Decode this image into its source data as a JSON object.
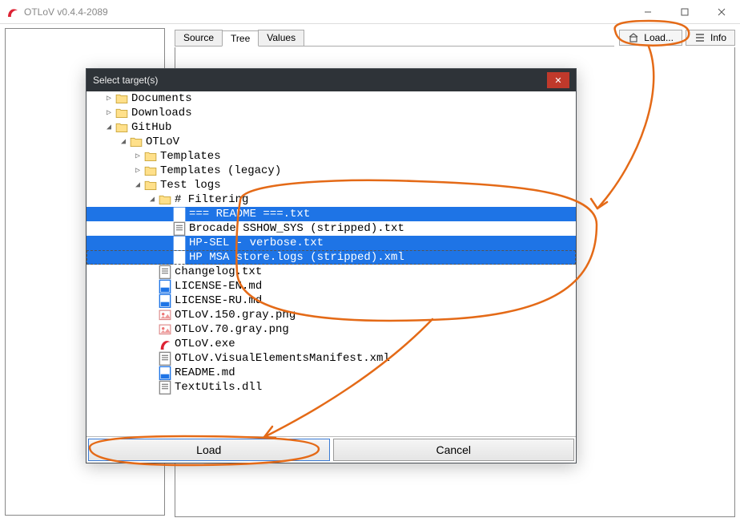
{
  "window": {
    "title": "OTLoV v0.4.4-2089"
  },
  "tabs": [
    "Source",
    "Tree",
    "Values"
  ],
  "activeTab": 1,
  "toolbar": {
    "load_label": "Load...",
    "info_label": "Info"
  },
  "dialog": {
    "title": "Select target(s)",
    "load_label": "Load",
    "cancel_label": "Cancel",
    "tree": [
      {
        "indent": 1,
        "toggler": "▶",
        "icon": "folder",
        "label": "Documents",
        "sel": false
      },
      {
        "indent": 1,
        "toggler": "▶",
        "icon": "folder",
        "label": "Downloads",
        "sel": false
      },
      {
        "indent": 1,
        "toggler": "▲",
        "icon": "folder",
        "label": "GitHub",
        "sel": false
      },
      {
        "indent": 2,
        "toggler": "▲",
        "icon": "folder",
        "label": "OTLoV",
        "sel": false
      },
      {
        "indent": 3,
        "toggler": "▶",
        "icon": "folder",
        "label": "Templates",
        "sel": false
      },
      {
        "indent": 3,
        "toggler": "▶",
        "icon": "folder",
        "label": "Templates (legacy)",
        "sel": false
      },
      {
        "indent": 3,
        "toggler": "▲",
        "icon": "folder",
        "label": "Test logs",
        "sel": false
      },
      {
        "indent": 4,
        "toggler": "▲",
        "icon": "folder",
        "label": "# Filtering",
        "sel": false
      },
      {
        "indent": 5,
        "toggler": "",
        "icon": "file",
        "label": "=== README ===.txt",
        "sel": true
      },
      {
        "indent": 5,
        "toggler": "",
        "icon": "file",
        "label": "Brocade SSHOW_SYS (stripped).txt",
        "sel": false
      },
      {
        "indent": 5,
        "toggler": "",
        "icon": "file",
        "label": "HP-SEL - verbose.txt",
        "sel": true
      },
      {
        "indent": 5,
        "toggler": "",
        "icon": "file",
        "label": "HP MSA store.logs (stripped).xml",
        "sel": true,
        "dashed": true
      },
      {
        "indent": 4,
        "toggler": "",
        "icon": "file",
        "label": "changelog.txt",
        "sel": false
      },
      {
        "indent": 4,
        "toggler": "",
        "icon": "md",
        "label": "LICENSE-EN.md",
        "sel": false
      },
      {
        "indent": 4,
        "toggler": "",
        "icon": "md",
        "label": "LICENSE-RU.md",
        "sel": false
      },
      {
        "indent": 4,
        "toggler": "",
        "icon": "img",
        "label": "OTLoV.150.gray.png",
        "sel": false
      },
      {
        "indent": 4,
        "toggler": "",
        "icon": "img",
        "label": "OTLoV.70.gray.png",
        "sel": false
      },
      {
        "indent": 4,
        "toggler": "",
        "icon": "exe",
        "label": "OTLoV.exe",
        "sel": false
      },
      {
        "indent": 4,
        "toggler": "",
        "icon": "file",
        "label": "OTLoV.VisualElementsManifest.xml",
        "sel": false
      },
      {
        "indent": 4,
        "toggler": "",
        "icon": "md",
        "label": "README.md",
        "sel": false
      },
      {
        "indent": 4,
        "toggler": "",
        "icon": "file",
        "label": "TextUtils.dll",
        "sel": false
      }
    ]
  },
  "annotation_color": "#e46a17"
}
